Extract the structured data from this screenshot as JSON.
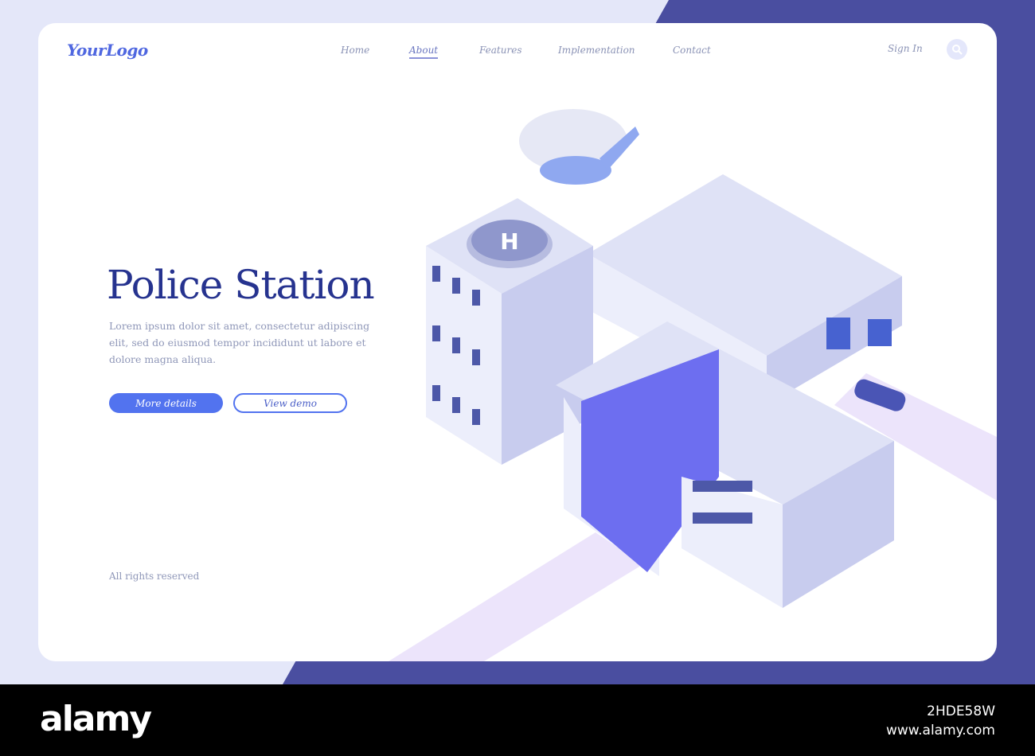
{
  "header": {
    "logo": "YourLogo",
    "nav": [
      {
        "label": "Home"
      },
      {
        "label": "About"
      },
      {
        "label": "Features"
      },
      {
        "label": "Implementation"
      },
      {
        "label": "Contact"
      }
    ],
    "sign_in": "Sign In"
  },
  "hero": {
    "title": "Police Station",
    "description": "Lorem ipsum dolor sit amet, consectetur adipiscing elit, sed do eiusmod tempor incididunt ut labore et dolore magna aliqua.",
    "primary_button": "More details",
    "secondary_button": "View demo"
  },
  "footer": {
    "rights": "All rights reserved"
  },
  "watermark": {
    "brand": "alamy",
    "image_code": "2HDE58W",
    "site": "www.alamy.com"
  },
  "colors": {
    "accent": "#5273ef",
    "title": "#26338f",
    "dark_bg": "#4a4ea0"
  }
}
